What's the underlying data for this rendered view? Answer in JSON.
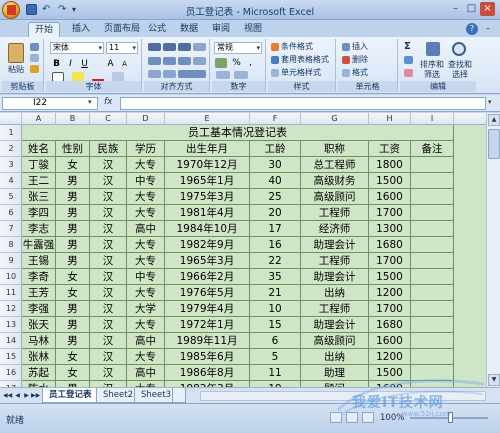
{
  "window": {
    "title": "员工登记表 - Microsoft Excel"
  },
  "tabs": [
    "开始",
    "插入",
    "页面布局",
    "公式",
    "数据",
    "审阅",
    "视图"
  ],
  "ribbon": {
    "clipboard": {
      "paste_label": "粘贴",
      "group_label": "剪贴板"
    },
    "font": {
      "name": "宋体",
      "size": "11",
      "bold": "B",
      "italic": "I",
      "underline": "U",
      "grow": "A",
      "shrink": "A",
      "group_label": "字体"
    },
    "alignment": {
      "group_label": "对齐方式"
    },
    "number": {
      "format": "常规",
      "percent": "%",
      "comma": ",",
      "group_label": "数字"
    },
    "styles": {
      "conditional": "条件格式",
      "table": "套用表格格式",
      "cell": "单元格样式",
      "group_label": "样式"
    },
    "cells": {
      "insert": "插入",
      "delete": "删除",
      "format": "格式",
      "group_label": "单元格"
    },
    "editing": {
      "sum": "Σ",
      "sort": "排序和",
      "sort2": "筛选",
      "find": "查找和",
      "find2": "选择",
      "group_label": "编辑"
    }
  },
  "formula_bar": {
    "name_box": "I22",
    "fx": "fx",
    "value": ""
  },
  "grid": {
    "columns": [
      "A",
      "B",
      "C",
      "D",
      "E",
      "F",
      "G",
      "H",
      "I"
    ],
    "rows": [
      "1",
      "2",
      "3",
      "4",
      "5",
      "6",
      "7",
      "8",
      "9",
      "10",
      "11",
      "12",
      "13",
      "14",
      "15",
      "16",
      "17",
      "18"
    ],
    "title": "员工基本情况登记表",
    "headers": [
      "姓名",
      "性别",
      "民族",
      "学历",
      "出生年月",
      "工龄",
      "职称",
      "工资",
      "备注"
    ],
    "records": [
      [
        "丁骏",
        "女",
        "汉",
        "大专",
        "1970年12月",
        "30",
        "总工程师",
        "1800",
        ""
      ],
      [
        "王二",
        "男",
        "汉",
        "中专",
        "1965年1月",
        "40",
        "高级财务",
        "1500",
        ""
      ],
      [
        "张三",
        "男",
        "汉",
        "大专",
        "1975年3月",
        "25",
        "高级顾问",
        "1600",
        ""
      ],
      [
        "李四",
        "男",
        "汉",
        "大专",
        "1981年4月",
        "20",
        "工程师",
        "1700",
        ""
      ],
      [
        "李志",
        "男",
        "汉",
        "高中",
        "1984年10月",
        "17",
        "经济师",
        "1300",
        ""
      ],
      [
        "牛露强",
        "男",
        "汉",
        "大专",
        "1982年9月",
        "16",
        "助理会计",
        "1680",
        ""
      ],
      [
        "王锡",
        "男",
        "汉",
        "大专",
        "1965年3月",
        "22",
        "工程师",
        "1700",
        ""
      ],
      [
        "李奇",
        "女",
        "汉",
        "中专",
        "1966年2月",
        "35",
        "助理会计",
        "1500",
        ""
      ],
      [
        "王芳",
        "女",
        "汉",
        "大专",
        "1976年5月",
        "21",
        "出纳",
        "1200",
        ""
      ],
      [
        "李强",
        "男",
        "汉",
        "大学",
        "1979年4月",
        "10",
        "工程师",
        "1700",
        ""
      ],
      [
        "张天",
        "男",
        "汉",
        "大专",
        "1972年1月",
        "15",
        "助理会计",
        "1680",
        ""
      ],
      [
        "马林",
        "男",
        "汉",
        "高中",
        "1989年11月",
        "6",
        "高级顾问",
        "1600",
        ""
      ],
      [
        "张林",
        "女",
        "汉",
        "大专",
        "1985年6月",
        "5",
        "出纳",
        "1200",
        ""
      ],
      [
        "苏起",
        "女",
        "汉",
        "高中",
        "1986年8月",
        "11",
        "助理",
        "1500",
        ""
      ],
      [
        "陈水",
        "男",
        "汉",
        "大专",
        "1982年3月",
        "19",
        "顾问",
        "1600",
        ""
      ]
    ]
  },
  "sheet_tabs": [
    "员工登记表",
    "Sheet2",
    "Sheet3"
  ],
  "status": {
    "text": "就绪",
    "zoom": "100%"
  },
  "watermark": {
    "text": "我爱IT技术网",
    "url": "www.52ij.com"
  }
}
